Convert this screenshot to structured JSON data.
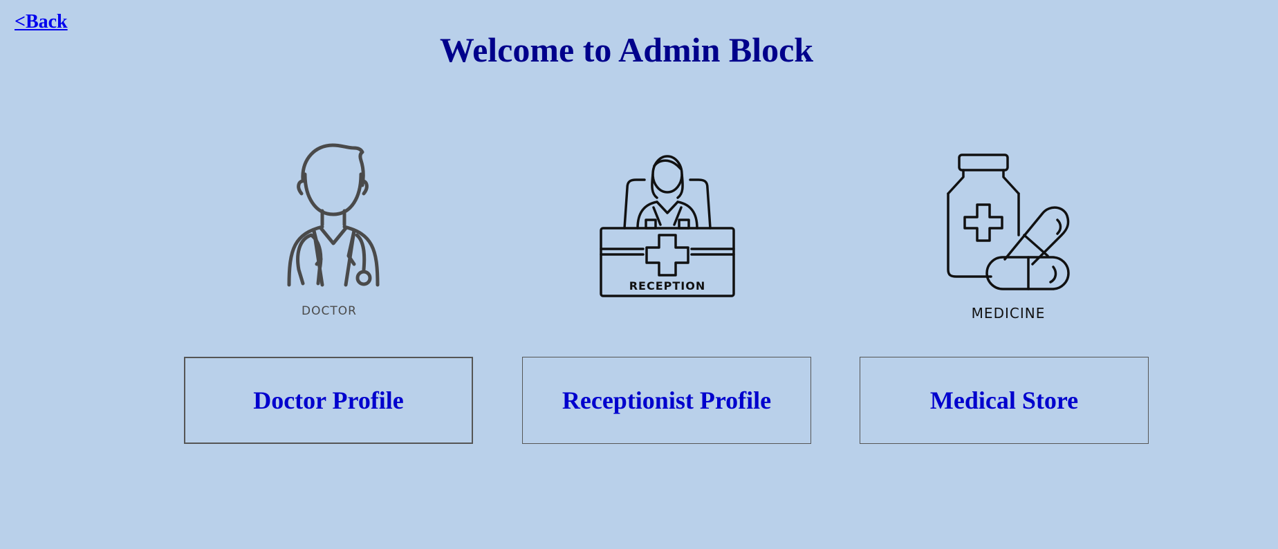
{
  "nav": {
    "back_label": "<Back"
  },
  "page": {
    "title": "Welcome to Admin Block"
  },
  "cards": [
    {
      "icon": "doctor-icon",
      "icon_label": "DOCTOR",
      "button_label": "Doctor Profile"
    },
    {
      "icon": "reception-icon",
      "icon_label": "RECEPTION",
      "button_label": "Receptionist Profile"
    },
    {
      "icon": "medicine-icon",
      "icon_label": "MEDICINE",
      "button_label": "Medical Store"
    }
  ],
  "colors": {
    "background": "#b9d0ea",
    "title": "#00008b",
    "button_text": "#0000cd",
    "link": "#0000ee"
  }
}
